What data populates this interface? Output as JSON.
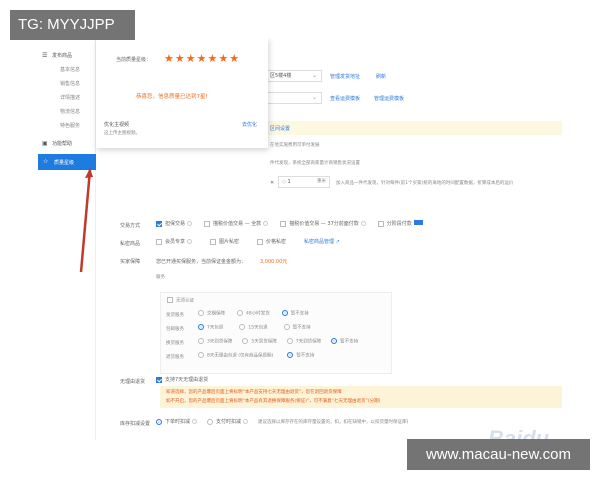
{
  "watermarks": {
    "top_left": "TG: MYYJJPP",
    "bottom_right": "www.macau-new.com",
    "baidu": "Baidu 经验"
  },
  "colors": {
    "accent": "#1e7ce0",
    "star": "#f26b1d",
    "warn_bg": "#fdf3d6",
    "arrow": "#c0392b"
  },
  "sidebar": {
    "group1": "发布商品",
    "subs": [
      "基本信息",
      "销售信息",
      "详情描述",
      "物流信息",
      "特色服务"
    ],
    "group2": "功能帮助",
    "active": "质量星级"
  },
  "popup": {
    "rating_label": "当前质量星级：",
    "stars": 7,
    "congrats": "恭喜您，信息质量已达到7星!",
    "optimize_title": "优化主视频",
    "optimize_desc": "这上传主图视频。",
    "optimize_link": "去优化"
  },
  "top_form": {
    "row1_select": "区5楼4楼",
    "row1_links": [
      "管理发货地址",
      "刷新"
    ],
    "row2_links": [
      "查看运费模板",
      "管理运费模板"
    ],
    "yellow_link": "区间设置",
    "note1": "在地实施费用可单付发展",
    "note2": "件代发现，系统全部商家量计商销售状况设置",
    "qty_value": "1",
    "qty_unit": "重米",
    "qty_hint": "加入商品一件代发现，针对每件(前1个买家)统的离地的时间配置数据，折算成本后的运价"
  },
  "trade": {
    "label": "交易方式",
    "options": [
      "担保交易",
      "描税价值交易 — 全款",
      "描税价值交易 — 37分前面付款",
      "分阶段付款"
    ],
    "checked": 0
  },
  "private": {
    "label": "私密商品",
    "options": [
      "会员专享",
      "图片私密",
      "价格私密"
    ],
    "link": "私密商品管理"
  },
  "deposit": {
    "label": "买家保障",
    "text": "您已开通买保服务，当前保证金金额为：",
    "amount": "3,000.00元"
  },
  "service_box": {
    "caption": "服务",
    "subtitle_line": "无须认证",
    "rows": [
      {
        "label": "发货服务",
        "opts": [
          "交期保障",
          "48小时发货",
          "暂不支持"
        ],
        "selected": 2
      },
      {
        "label": "包邮服务",
        "opts": [
          "7天包退",
          "15天包退",
          "暂不支持"
        ],
        "selected": 0
      },
      {
        "label": "换货服务",
        "opts": [
          "3天到货保障",
          "5天到货保障",
          "7天到货保障",
          "暂不支持"
        ],
        "selected": 3
      },
      {
        "label": "退货服务",
        "opts": [
          "8天无理由包退 (仅有商品保质期)",
          "暂不支持"
        ],
        "selected": 1
      }
    ]
  },
  "no_reason": {
    "label": "无理由退货",
    "text": "支持7天无理由退货"
  },
  "warning": {
    "line1": "知道选择，您的产品爆后页面上将标明“本产品支持七天无理由退货”，您在退回退货保障",
    "line2": "如不开启，您的产品爆后页面上将标明“本产品有其退换保障服务(保证)”，可不满意“七天无理由退货”(分期)"
  },
  "inventory": {
    "label": "库存扣减设置",
    "options": [
      "下单时扣减",
      "支付时扣减"
    ],
    "selected": 0,
    "hint": "建议选择以库存存在的库存量设置的，扣，扣在缺销中，以扣货量时保证库存为内..."
  }
}
